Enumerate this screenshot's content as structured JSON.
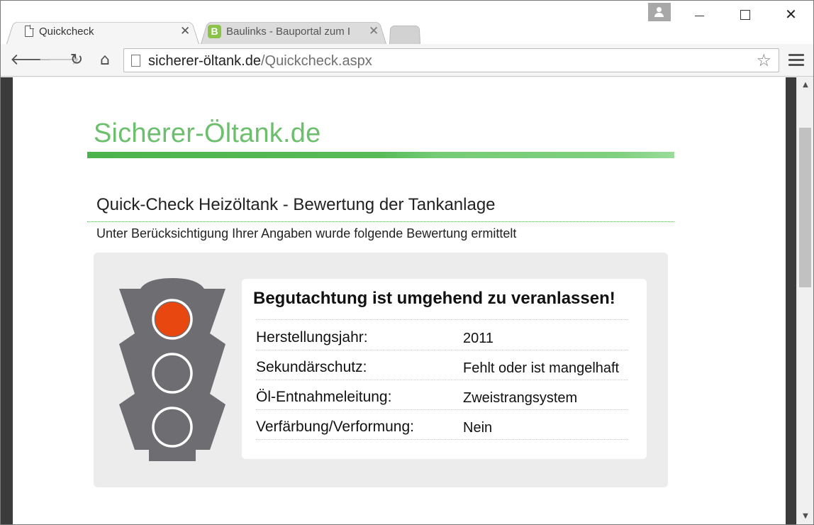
{
  "browser": {
    "tabs": [
      {
        "title": "Quickcheck",
        "active": true
      },
      {
        "title": "Baulinks - Bauportal zum I",
        "favicon": "B",
        "active": false
      }
    ],
    "url": {
      "domain": "sicherer-öltank.de",
      "path": "/Quickcheck.aspx"
    },
    "icons": {
      "back": "back-arrow-icon",
      "forward": "forward-arrow-icon",
      "reload": "reload-icon",
      "home": "home-icon",
      "bookmark": "star-icon",
      "menu": "hamburger-menu-icon",
      "profile": "profile-icon"
    }
  },
  "site": {
    "logo_text": "Sicherer-Öltank.de",
    "heading": "Quick-Check Heizöltank - Bewertung der Tankanlage",
    "subheading": "Unter Berücksichtigung Ihrer Angaben wurde folgende Bewertung ermittelt",
    "traffic_light": {
      "active": "red",
      "active_color": "#e8470f"
    },
    "result": {
      "verdict": "Begutachtung ist umgehend zu veranlassen!",
      "rows": [
        {
          "label": "Herstellungsjahr:",
          "value": "2011"
        },
        {
          "label": "Sekundärschutz:",
          "value": "Fehlt oder ist mangelhaft"
        },
        {
          "label": "Öl-Entnahmeleitung:",
          "value": "Zweistrangsystem"
        },
        {
          "label": "Verfärbung/Verformung:",
          "value": "Nein"
        }
      ]
    }
  },
  "colors": {
    "brand_green": "#6cbf6c",
    "red_light": "#e8470f",
    "housing": "#6d6d72"
  }
}
